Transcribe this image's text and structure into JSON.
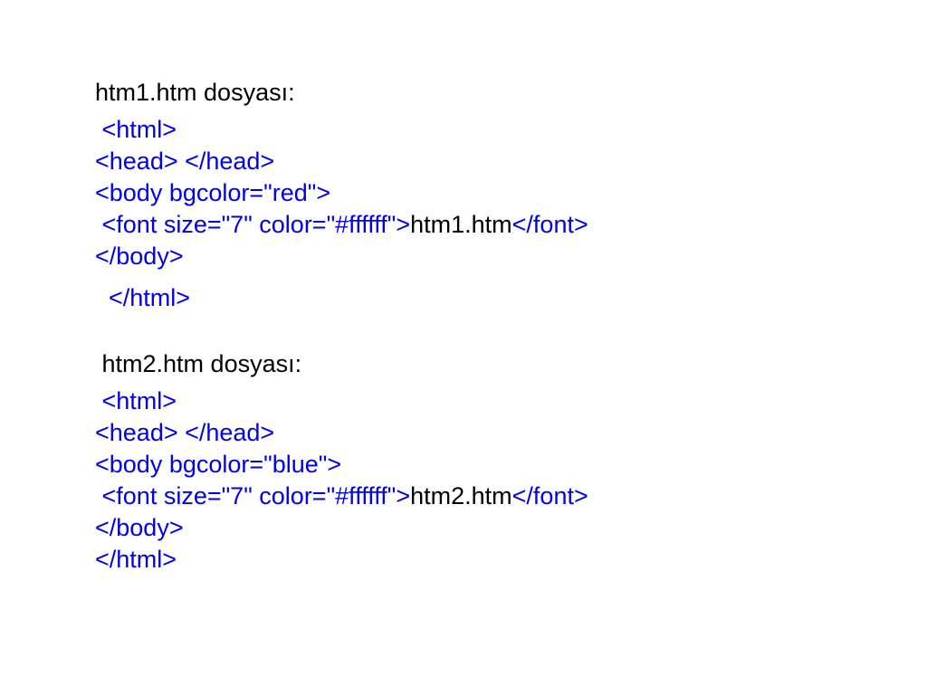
{
  "section1": {
    "heading": "htm1.htm dosyası:",
    "lines": [
      {
        "indent": " ",
        "tokens": [
          {
            "cls": "tag",
            "text": "<html>"
          }
        ]
      },
      {
        "indent": "",
        "tokens": [
          {
            "cls": "tag",
            "text": "<head> </head>"
          }
        ]
      },
      {
        "indent": "",
        "tokens": [
          {
            "cls": "tag",
            "text": "<body bgcolor=\"red\">"
          }
        ]
      },
      {
        "indent": " ",
        "tokens": [
          {
            "cls": "tag",
            "text": "<font size=\"7\" color=\"#ffffff\">"
          },
          {
            "cls": "txt",
            "text": "htm1.htm"
          },
          {
            "cls": "tag",
            "text": "</font>"
          }
        ]
      },
      {
        "indent": "",
        "tokens": [
          {
            "cls": "tag",
            "text": "</body>"
          }
        ]
      }
    ],
    "close": "</html>",
    "close_indent": "  "
  },
  "section2": {
    "heading": "htm2.htm dosyası:",
    "heading_indent": " ",
    "lines": [
      {
        "indent": " ",
        "tokens": [
          {
            "cls": "tag",
            "text": "<html>"
          }
        ]
      },
      {
        "indent": "",
        "tokens": [
          {
            "cls": "tag",
            "text": "<head> </head>"
          }
        ]
      },
      {
        "indent": "",
        "tokens": [
          {
            "cls": "tag",
            "text": "<body bgcolor=\"blue\">"
          }
        ]
      },
      {
        "indent": " ",
        "tokens": [
          {
            "cls": "tag",
            "text": "<font size=\"7\" color=\"#ffffff\">"
          },
          {
            "cls": "txt",
            "text": "htm2.htm"
          },
          {
            "cls": "tag",
            "text": "</font>"
          }
        ]
      },
      {
        "indent": "",
        "tokens": [
          {
            "cls": "tag",
            "text": "</body>"
          }
        ]
      },
      {
        "indent": "",
        "tokens": [
          {
            "cls": "tag",
            "text": "</html>"
          }
        ]
      }
    ]
  }
}
